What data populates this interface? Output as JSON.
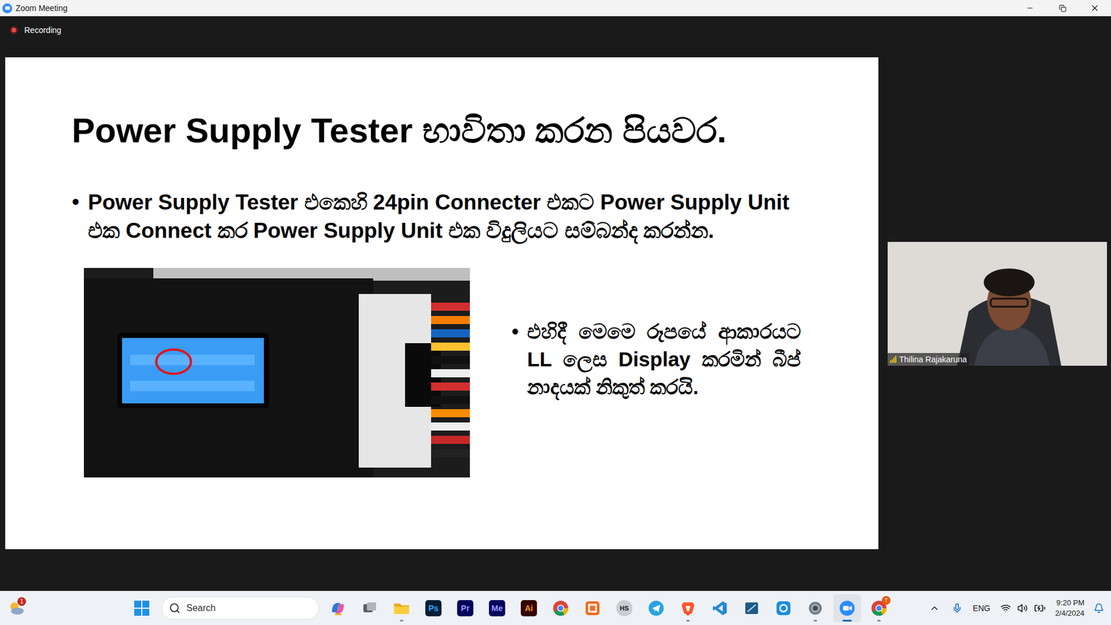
{
  "window": {
    "title": "Zoom Meeting"
  },
  "recording": {
    "label": "Recording",
    "on": true
  },
  "slide": {
    "title": "Power Supply Tester භාවිතා කරන පියවර.",
    "bullets": [
      "Power Supply Tester එකෙහි 24pin  Connecter එකට Power Supply Unit එක Connect කර Power Supply Unit එක විදුලියට සම්බන්ද කරන්න."
    ],
    "caption_bullet": "එහිදී මෙමෙ රූපයේ ආකාරයට LL ලෙස Display කරමින් බීප් නාදයක් නිකුත් කරයි."
  },
  "participant": {
    "name": "Thilina Rajakaruna",
    "signal": 4
  },
  "taskbar": {
    "weather_badge": "1",
    "search": {
      "placeholder": "Search"
    },
    "apps": [
      {
        "kind": "copilot",
        "running": false,
        "active": false
      },
      {
        "kind": "task-view",
        "running": false,
        "active": false
      },
      {
        "kind": "explorer",
        "running": true,
        "active": false
      },
      {
        "kind": "text-tile",
        "label": "Ps",
        "color": "#31a8ff",
        "background": "#001e36",
        "running": false,
        "active": false
      },
      {
        "kind": "text-tile",
        "label": "Pr",
        "color": "#9999ff",
        "background": "#00005b",
        "running": false,
        "active": false
      },
      {
        "kind": "text-tile",
        "label": "Me",
        "color": "#9999ff",
        "background": "#00005b",
        "running": false,
        "active": false
      },
      {
        "kind": "text-tile",
        "label": "Ai",
        "color": "#ff9a00",
        "background": "#330000",
        "running": false,
        "active": false
      },
      {
        "kind": "chrome",
        "running": false,
        "active": false
      },
      {
        "kind": "app",
        "running": false,
        "active": false
      },
      {
        "kind": "round-tile",
        "label": "HS",
        "color": "#111111",
        "background": "#c9cdd2",
        "running": false,
        "active": false
      },
      {
        "kind": "telegram",
        "running": false,
        "active": false
      },
      {
        "kind": "brave",
        "running": true,
        "active": false
      },
      {
        "kind": "vscode",
        "running": false,
        "active": false
      },
      {
        "kind": "remote",
        "running": false,
        "active": false
      },
      {
        "kind": "sync",
        "running": false,
        "active": false
      },
      {
        "kind": "settings",
        "running": true,
        "active": false
      },
      {
        "kind": "zoom",
        "running": true,
        "active": true
      },
      {
        "kind": "chrome",
        "badge": "T",
        "running": true,
        "active": false
      }
    ],
    "tray": {
      "language": "ENG",
      "time": "9:20 PM",
      "date": "2/4/2024"
    }
  }
}
